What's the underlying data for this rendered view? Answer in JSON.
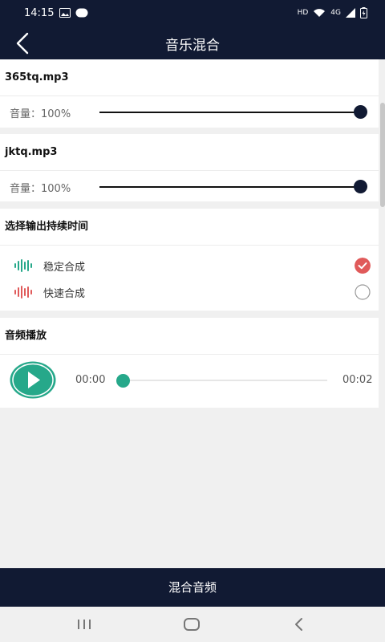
{
  "status": {
    "time": "14:15",
    "hd": "HD",
    "network": "4G"
  },
  "appbar": {
    "title": "音乐混合"
  },
  "tracks": [
    {
      "name": "365tq.mp3",
      "volume_label": "音量：100%",
      "volume": 100
    },
    {
      "name": "jktq.mp3",
      "volume_label": "音量：100%",
      "volume": 100
    }
  ],
  "duration": {
    "title": "选择输出持续时间",
    "options": [
      {
        "label": "稳定合成",
        "selected": true,
        "color": "#26a88a"
      },
      {
        "label": "快速合成",
        "selected": false,
        "color": "#e05a5a"
      }
    ]
  },
  "player": {
    "title": "音频播放",
    "current": "00:00",
    "total": "00:02",
    "progress": 0
  },
  "action": {
    "label": "混合音频"
  },
  "colors": {
    "primary": "#111a33",
    "accent": "#26a88a",
    "selected": "#e05a5a"
  }
}
